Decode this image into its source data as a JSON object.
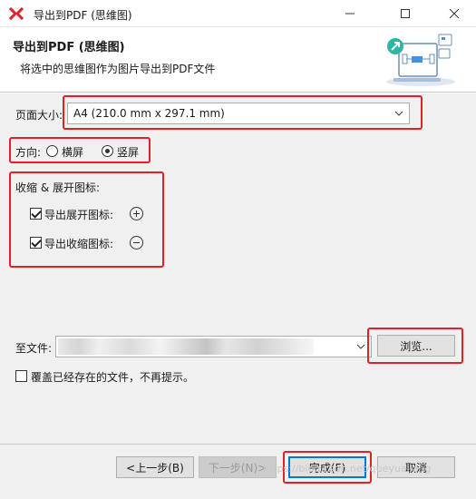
{
  "window": {
    "title": "导出到PDF (思维图)",
    "accent_color": "#e0202a"
  },
  "header": {
    "title": "导出到PDF (思维图)",
    "subtitle": "将选中的思维图作为图片导出到PDF文件"
  },
  "page_size": {
    "label": "页面大小:",
    "value": "A4 (210.0 mm x 297.1 mm)"
  },
  "orientation": {
    "label": "方向:",
    "options": [
      {
        "label": "横屏",
        "selected": false
      },
      {
        "label": "竖屏",
        "selected": true
      }
    ]
  },
  "collapse": {
    "label": "收缩 & 展开图标:",
    "options": [
      {
        "label": "导出展开图标:",
        "checked": true,
        "icon": "plus-circle-icon"
      },
      {
        "label": "导出收缩图标:",
        "checked": true,
        "icon": "minus-circle-icon"
      }
    ]
  },
  "file": {
    "label": "至文件:",
    "browse_label": "浏览..."
  },
  "overwrite": {
    "label": "覆盖已经存在的文件，不再提示。",
    "checked": false
  },
  "buttons": {
    "back": "<上一步(B)",
    "next": "下一步(N)>",
    "finish": "完成(F)",
    "cancel": "取消"
  },
  "watermark": "https://blog.csdn.net/queyualiang"
}
